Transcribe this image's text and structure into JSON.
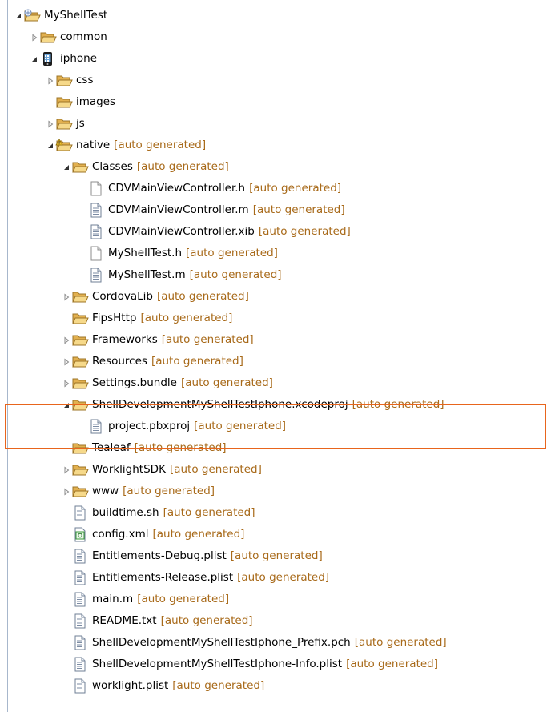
{
  "tree": {
    "auto_label": "[auto generated]",
    "rows": [
      {
        "name": "MyShellTest",
        "depth": 0,
        "icon": "project-folder-icon",
        "state": "expanded",
        "auto": false
      },
      {
        "name": "common",
        "depth": 1,
        "icon": "folder-icon",
        "state": "collapsed",
        "auto": false
      },
      {
        "name": "iphone",
        "depth": 1,
        "icon": "iphone-device-icon",
        "state": "expanded",
        "auto": false
      },
      {
        "name": "css",
        "depth": 2,
        "icon": "folder-icon",
        "state": "collapsed",
        "auto": false
      },
      {
        "name": "images",
        "depth": 2,
        "icon": "folder-icon",
        "state": "none",
        "auto": false
      },
      {
        "name": "js",
        "depth": 2,
        "icon": "folder-icon",
        "state": "collapsed",
        "auto": false
      },
      {
        "name": "native",
        "depth": 2,
        "icon": "native-folder-icon",
        "state": "expanded",
        "auto": true
      },
      {
        "name": "Classes",
        "depth": 3,
        "icon": "folder-icon",
        "state": "expanded",
        "auto": true
      },
      {
        "name": "CDVMainViewController.h",
        "depth": 4,
        "icon": "blank-file-icon",
        "state": "none",
        "auto": true
      },
      {
        "name": "CDVMainViewController.m",
        "depth": 4,
        "icon": "text-file-icon",
        "state": "none",
        "auto": true
      },
      {
        "name": "CDVMainViewController.xib",
        "depth": 4,
        "icon": "text-file-icon",
        "state": "none",
        "auto": true
      },
      {
        "name": "MyShellTest.h",
        "depth": 4,
        "icon": "blank-file-icon",
        "state": "none",
        "auto": true
      },
      {
        "name": "MyShellTest.m",
        "depth": 4,
        "icon": "text-file-icon",
        "state": "none",
        "auto": true
      },
      {
        "name": "CordovaLib",
        "depth": 3,
        "icon": "folder-icon",
        "state": "collapsed",
        "auto": true
      },
      {
        "name": "FipsHttp",
        "depth": 3,
        "icon": "folder-icon",
        "state": "none",
        "auto": true
      },
      {
        "name": "Frameworks",
        "depth": 3,
        "icon": "folder-icon",
        "state": "collapsed",
        "auto": true
      },
      {
        "name": "Resources",
        "depth": 3,
        "icon": "folder-icon",
        "state": "collapsed",
        "auto": true
      },
      {
        "name": "Settings.bundle",
        "depth": 3,
        "icon": "folder-icon",
        "state": "collapsed",
        "auto": true
      },
      {
        "name": "ShellDevelopmentMyShellTestIphone.xcodeproj",
        "depth": 3,
        "icon": "folder-icon",
        "state": "expanded",
        "auto": true
      },
      {
        "name": "project.pbxproj",
        "depth": 4,
        "icon": "text-file-icon",
        "state": "none",
        "auto": true
      },
      {
        "name": "Tealeaf",
        "depth": 3,
        "icon": "folder-icon",
        "state": "none",
        "auto": true
      },
      {
        "name": "WorklightSDK",
        "depth": 3,
        "icon": "folder-icon",
        "state": "collapsed",
        "auto": true
      },
      {
        "name": "www",
        "depth": 3,
        "icon": "folder-icon",
        "state": "collapsed",
        "auto": true
      },
      {
        "name": "buildtime.sh",
        "depth": 3,
        "icon": "text-file-icon",
        "state": "none",
        "auto": true
      },
      {
        "name": "config.xml",
        "depth": 3,
        "icon": "xml-file-icon",
        "state": "none",
        "auto": true
      },
      {
        "name": "Entitlements-Debug.plist",
        "depth": 3,
        "icon": "text-file-icon",
        "state": "none",
        "auto": true
      },
      {
        "name": "Entitlements-Release.plist",
        "depth": 3,
        "icon": "text-file-icon",
        "state": "none",
        "auto": true
      },
      {
        "name": "main.m",
        "depth": 3,
        "icon": "text-file-icon",
        "state": "none",
        "auto": true
      },
      {
        "name": "README.txt",
        "depth": 3,
        "icon": "text-file-icon",
        "state": "none",
        "auto": true
      },
      {
        "name": "ShellDevelopmentMyShellTestIphone_Prefix.pch",
        "depth": 3,
        "icon": "text-file-icon",
        "state": "none",
        "auto": true
      },
      {
        "name": "ShellDevelopmentMyShellTestIphone-Info.plist",
        "depth": 3,
        "icon": "text-file-icon",
        "state": "none",
        "auto": true
      },
      {
        "name": "worklight.plist",
        "depth": 3,
        "icon": "text-file-icon",
        "state": "none",
        "auto": true
      }
    ]
  },
  "colors": {
    "auto_generated_text": "#a86a1a",
    "highlight_border": "#e8651d",
    "folder": "#e9c46b"
  }
}
